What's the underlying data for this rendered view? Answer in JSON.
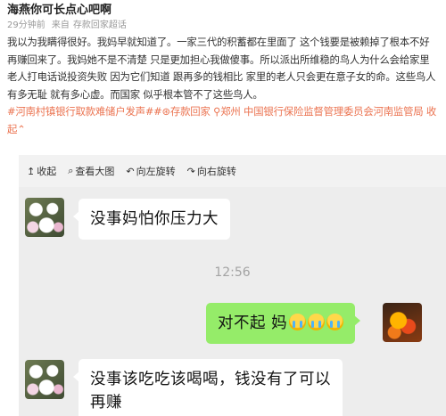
{
  "post": {
    "author": "海燕你可长点心吧啊",
    "time": "29分钟前",
    "source_prefix": "来自",
    "source": "存款回家超话",
    "text": "我以为我瞒得很好。我妈早就知道了。一家三代的积蓄都在里面了 这个钱要是被赖掉了根本不好再赚回来了。我妈她不是不清楚 只是更加担心我做傻事。所以派出所维稳的鸟人为什么会给家里老人打电话说投资失败 因为它们知道 跟再多的钱相比 家里的老人只会更在意子女的命。这些鸟人有多无耻 就有多心虚。而国家 似乎根本管不了这些鸟人。",
    "tags": [
      "#河南村镇银行取款难储户发声#",
      "存款回家",
      "郑州",
      "中国银行保险监督管理委员会河南监管局"
    ],
    "collapse_label": "收起",
    "collapse_icon": "chevron-up-icon"
  },
  "toolbar": {
    "items": [
      {
        "icon": "collapse-up-icon",
        "glyph": "↥",
        "label": "收起"
      },
      {
        "icon": "zoom-icon",
        "glyph": "⌕",
        "label": "查看大图"
      },
      {
        "icon": "rotate-left-icon",
        "glyph": "↶",
        "label": "向左旋转"
      },
      {
        "icon": "rotate-right-icon",
        "glyph": "↷",
        "label": "向右旋转"
      }
    ]
  },
  "chat": {
    "msg1": "没事妈怕你压力大",
    "time": "12:56",
    "msg2": "对不起 妈",
    "msg2_emoji_count": 3,
    "msg3_line1": "没事该吃吃该喝喝，钱没有了可以",
    "msg3_line2": "再赚"
  },
  "colors": {
    "link": "#eb7350",
    "bubble_self": "#95ec69",
    "bubble_other": "#ffffff",
    "chat_bg": "#ededed"
  }
}
